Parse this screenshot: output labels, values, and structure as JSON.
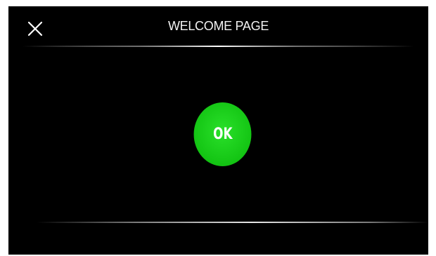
{
  "header": {
    "title": "WELCOME PAGE",
    "close_icon": "close-icon"
  },
  "main": {
    "ok_label": "OK"
  },
  "colors": {
    "background": "#000000",
    "ok_button": "#13c413",
    "text": "#ffffff"
  }
}
